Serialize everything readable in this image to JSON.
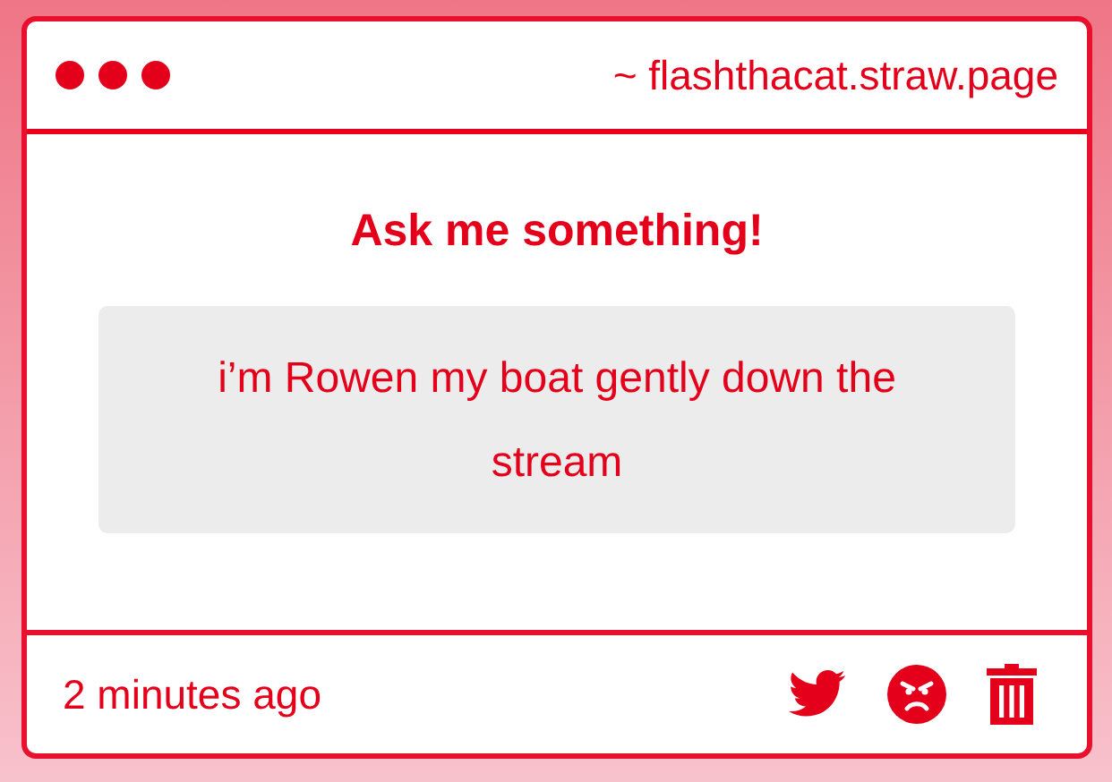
{
  "window": {
    "address": "~ flashthacat.straw.page"
  },
  "prompt": "Ask me something!",
  "answer": "i’m Rowen my boat gently down the stream",
  "footer": {
    "time": "2 minutes ago"
  }
}
